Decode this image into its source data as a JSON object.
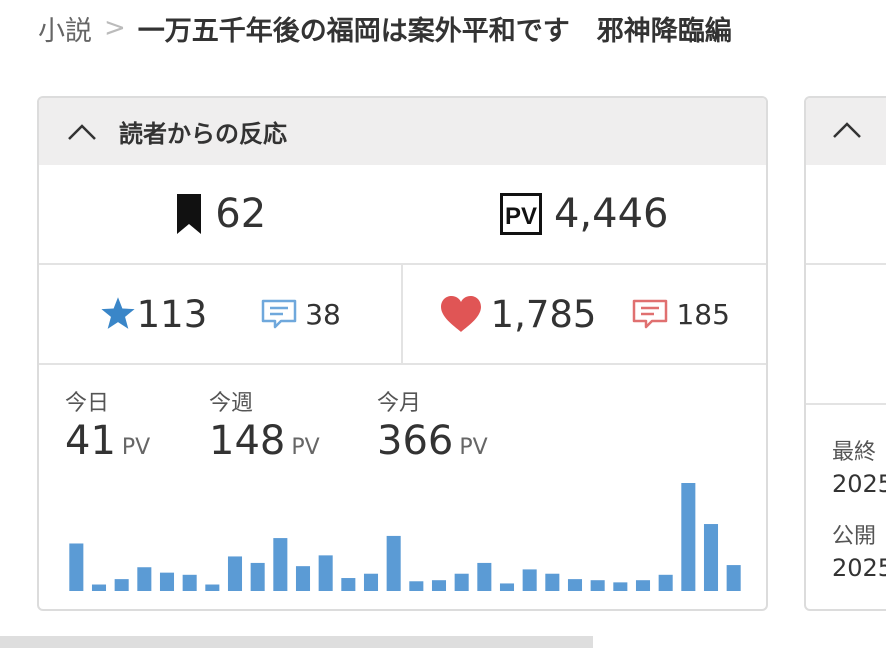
{
  "breadcrumb": {
    "root": "小説",
    "separator": ">",
    "title": "一万五千年後の福岡は案外平和です　邪神降臨編"
  },
  "reactions_card": {
    "header_title": "読者からの反応",
    "bookmarks": "62",
    "pv_total": "4,446",
    "stars": "113",
    "star_comments": "38",
    "likes": "1,785",
    "like_comments": "185",
    "pv_period": [
      {
        "label": "今日",
        "value": "41",
        "unit": "PV"
      },
      {
        "label": "今週",
        "value": "148",
        "unit": "PV"
      },
      {
        "label": "今月",
        "value": "366",
        "unit": "PV"
      }
    ]
  },
  "side_card": {
    "last_updated_label": "最終",
    "last_updated_value": "2025",
    "published_label": "公開",
    "published_value": "2025"
  },
  "colors": {
    "bar": "#5b9bd5",
    "star": "#3a86c8",
    "star_comment": "#6fa8dc",
    "heart": "#e05555",
    "heart_comment": "#e07070",
    "header_bg": "#efeeee"
  },
  "chart_data": {
    "type": "bar",
    "values": [
      44,
      6,
      11,
      22,
      17,
      15,
      6,
      32,
      26,
      49,
      23,
      33,
      12,
      16,
      51,
      9,
      10,
      16,
      26,
      7,
      20,
      16,
      11,
      10,
      8,
      10,
      15,
      100,
      62,
      24
    ],
    "ylim": [
      0,
      100
    ],
    "xlabel": "",
    "ylabel": ""
  }
}
